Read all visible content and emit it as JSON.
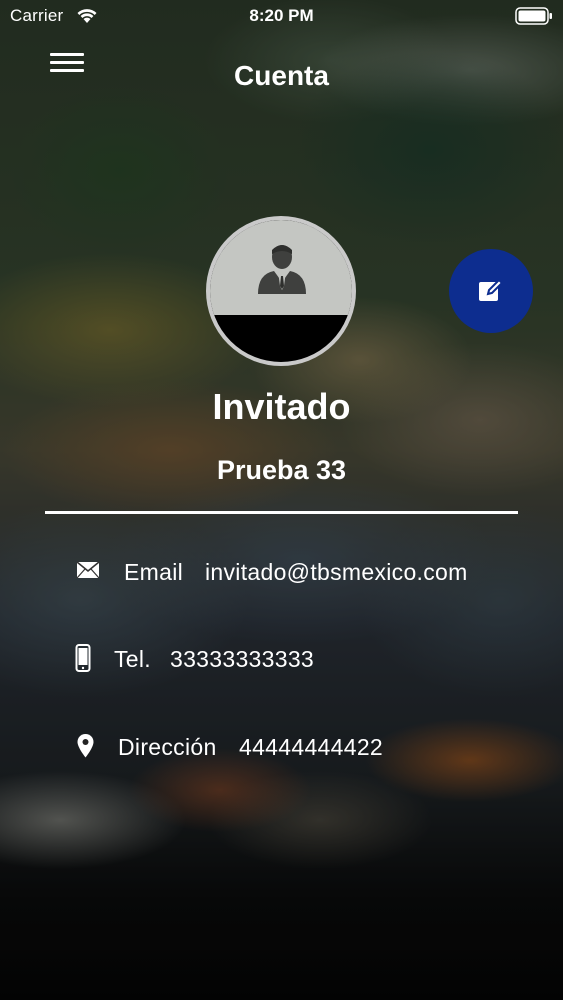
{
  "status_bar": {
    "carrier": "Carrier",
    "time": "8:20 PM",
    "wifi_icon": "wifi-icon",
    "battery_icon": "battery-icon"
  },
  "nav": {
    "title": "Cuenta",
    "menu_icon": "hamburger-menu-icon"
  },
  "profile": {
    "avatar_icon": "user-person-icon",
    "name": "Invitado",
    "subtitle": "Prueba 33",
    "edit_icon": "edit-pencil-icon"
  },
  "info": {
    "email": {
      "icon": "mail-icon",
      "label": "Email",
      "value": "invitado@tbsmexico.com"
    },
    "phone": {
      "icon": "smartphone-icon",
      "label": "Tel.",
      "value": "33333333333"
    },
    "address": {
      "icon": "location-pin-icon",
      "label": "Dirección",
      "value": "44444444422"
    }
  },
  "colors": {
    "fab": "#0d2d8f",
    "text": "#ffffff",
    "avatar_border": "#c9c9c9",
    "avatar_fill": "#c4c6c2"
  }
}
